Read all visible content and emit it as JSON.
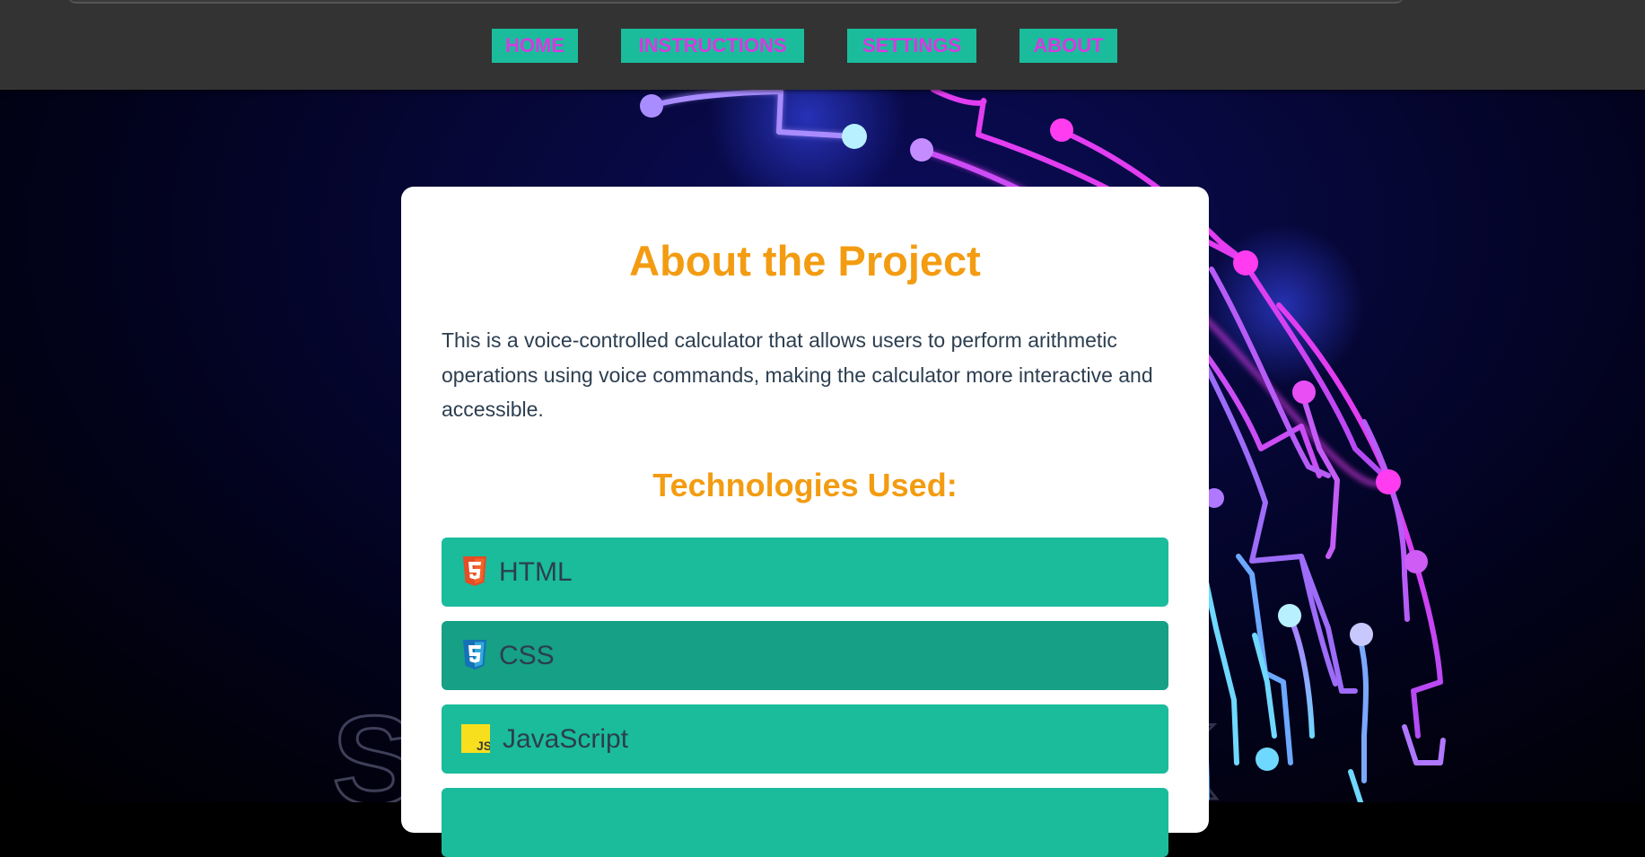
{
  "nav": {
    "items": [
      {
        "label": "HOME"
      },
      {
        "label": "INSTRUCTIONS"
      },
      {
        "label": "SETTINGS"
      },
      {
        "label": "ABOUT"
      }
    ]
  },
  "about": {
    "title": "About the Project",
    "description": "This is a voice-controlled calculator that allows users to perform arithmetic operations using voice commands, making the calculator more interactive and accessible.",
    "tech_heading": "Technologies Used:",
    "technologies": [
      {
        "label": "HTML",
        "icon": "html5-icon"
      },
      {
        "label": "CSS",
        "icon": "css3-icon"
      },
      {
        "label": "JavaScript",
        "icon": "javascript-icon"
      },
      {
        "label": ""
      }
    ]
  },
  "background": {
    "watermark_text": "S K"
  },
  "colors": {
    "nav_bg": "#333333",
    "nav_button_bg": "#1abc9c",
    "nav_text": "#d63adf",
    "heading": "#f39c12",
    "body_text": "#2c3e50",
    "tech_item_bg": "#1abc9c",
    "tech_item_hover_bg": "#16a085",
    "card_bg": "#ffffff"
  }
}
